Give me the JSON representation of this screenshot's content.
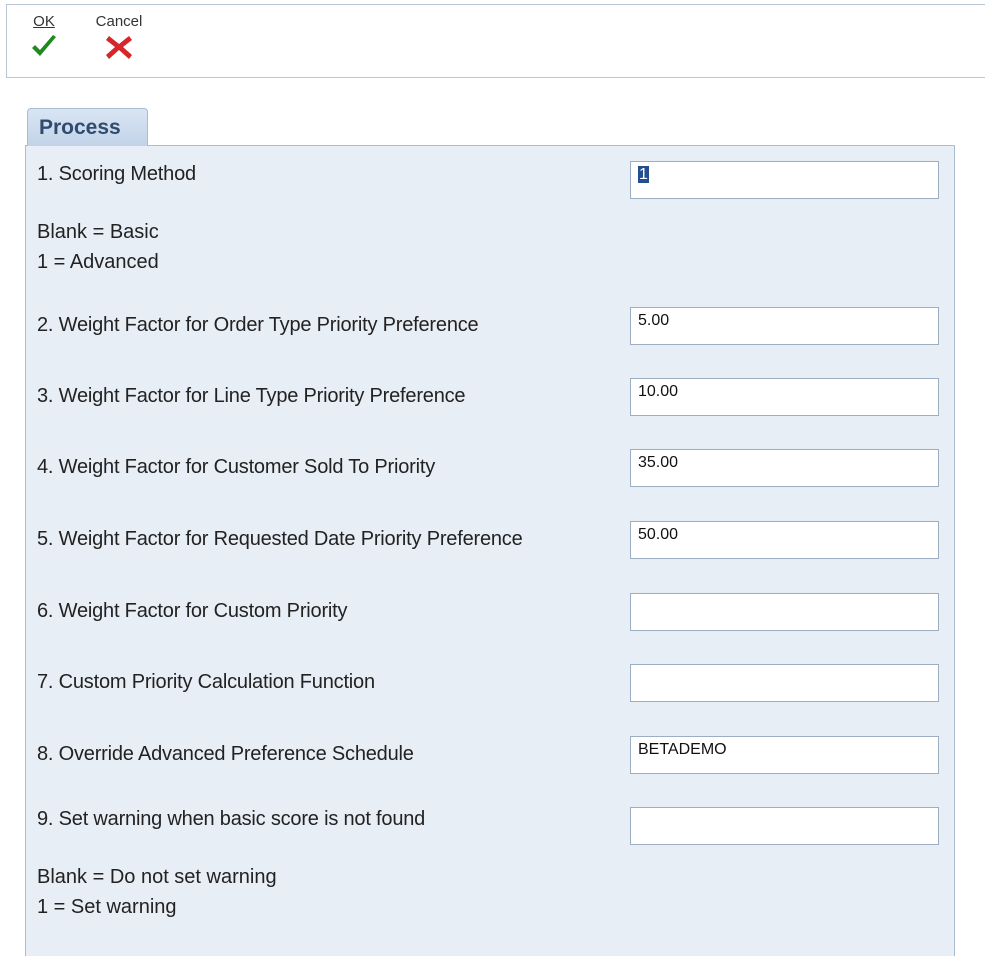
{
  "toolbar": {
    "ok_label": "OK",
    "cancel_label": "Cancel",
    "ok_icon": "checkmark-icon",
    "cancel_icon": "x-close-icon",
    "ok_color": "#1f8a1f",
    "cancel_color": "#d6262b"
  },
  "tab": {
    "label": "Process"
  },
  "options": [
    {
      "label": "1. Scoring Method",
      "value": "1"
    },
    {
      "label": "2. Weight Factor for Order Type Priority Preference",
      "value": "5.00"
    },
    {
      "label": "3. Weight Factor for Line Type Priority Preference",
      "value": "10.00"
    },
    {
      "label": "4. Weight Factor for Customer Sold To Priority",
      "value": "35.00"
    },
    {
      "label": "5. Weight Factor for Requested Date Priority Preference",
      "value": "50.00"
    },
    {
      "label": "6. Weight Factor for Custom Priority",
      "value": ""
    },
    {
      "label": "7. Custom Priority Calculation Function",
      "value": ""
    },
    {
      "label": "8. Override Advanced Preference Schedule",
      "value": "BETADEMO"
    },
    {
      "label": "9. Set warning when basic score is not found",
      "value": ""
    }
  ],
  "notes": {
    "scoring_blank": "Blank = Basic",
    "scoring_one": "1 = Advanced",
    "warning_blank": "Blank = Do not set warning",
    "warning_one": "1 = Set warning"
  },
  "colors": {
    "panel_bg": "#e8eef6",
    "tab_text": "#2f4c6f",
    "selection": "#244f8f"
  }
}
